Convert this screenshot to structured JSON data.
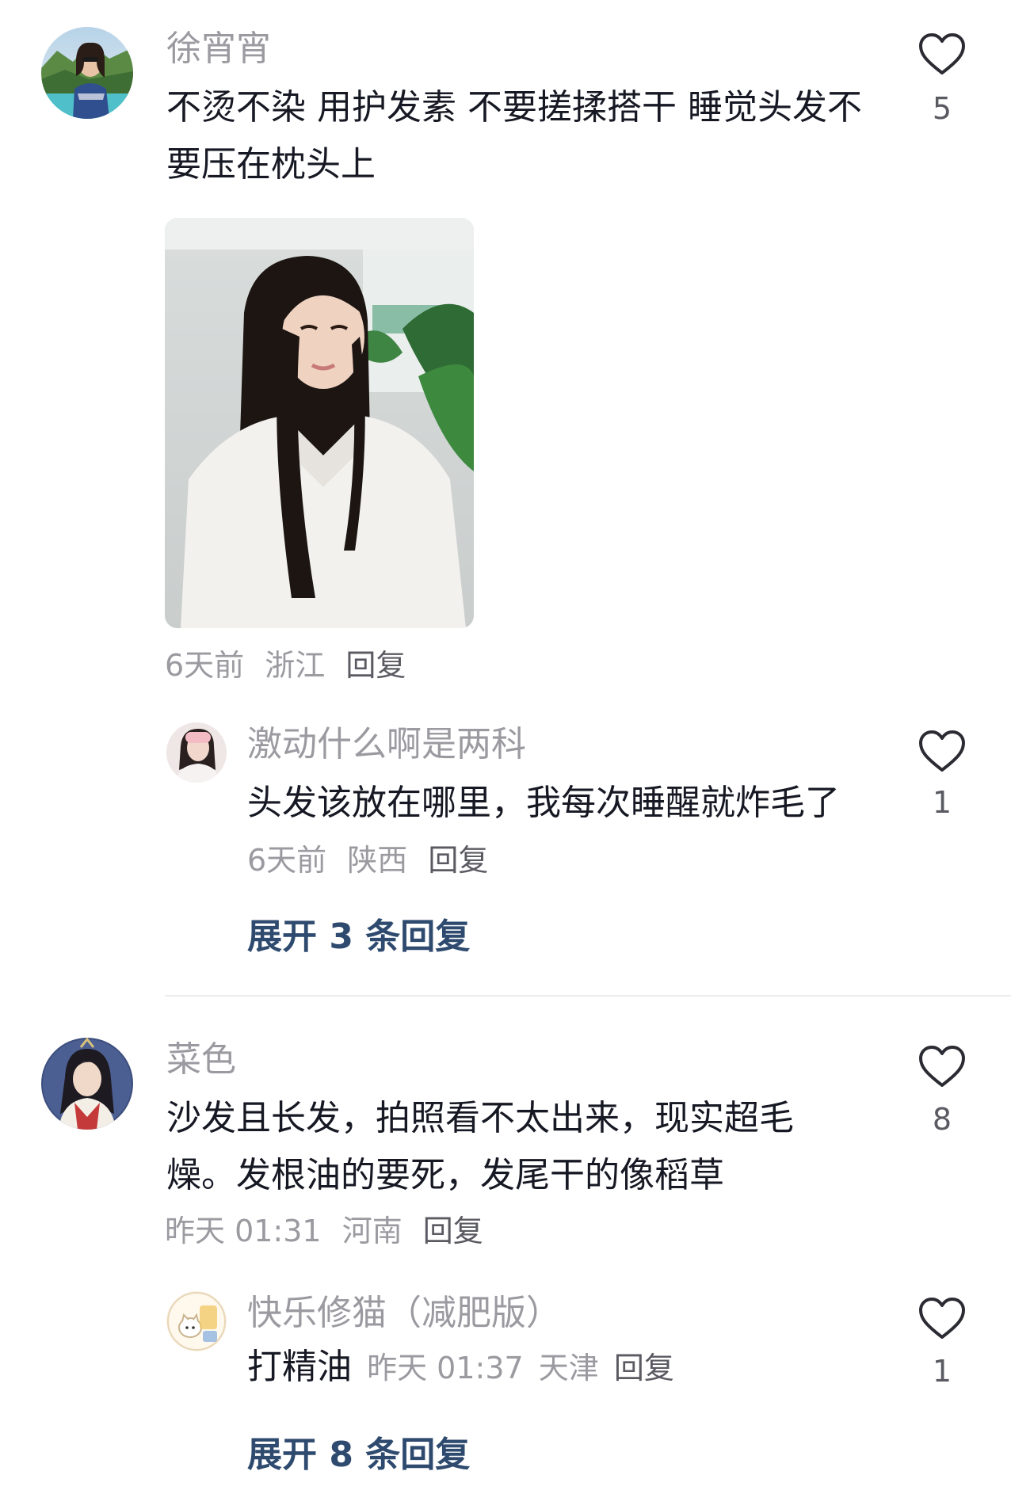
{
  "comments": [
    {
      "username": "徐宵宵",
      "text": "不烫不染 用护发素 不要搓揉搭干 睡觉头发不要压在枕头上",
      "time": "6天前",
      "location": "浙江",
      "reply_label": "回复",
      "likes": "5",
      "has_photo": true,
      "replies": [
        {
          "username": "激动什么啊是两科",
          "text": "头发该放在哪里，我每次睡醒就炸毛了",
          "time": "6天前",
          "location": "陕西",
          "reply_label": "回复",
          "likes": "1"
        }
      ],
      "expand_label": "展开 3 条回复"
    },
    {
      "username": "菜色",
      "text": "沙发且长发，拍照看不太出来，现实超毛燥。发根油的要死，发尾干的像稻草",
      "time": "昨天 01:31",
      "location": "河南",
      "reply_label": "回复",
      "likes": "8",
      "replies": [
        {
          "username": "快乐修猫（减肥版）",
          "text": "打精油",
          "time": "昨天 01:37",
          "location": "天津",
          "reply_label": "回复",
          "likes": "1"
        }
      ],
      "expand_label": "展开 8 条回复"
    }
  ],
  "icons": {
    "like": "heart-outline-icon"
  },
  "colors": {
    "expand_link": "#2e4a6e",
    "muted_text": "#9a9aa0",
    "primary_text": "#161823"
  }
}
